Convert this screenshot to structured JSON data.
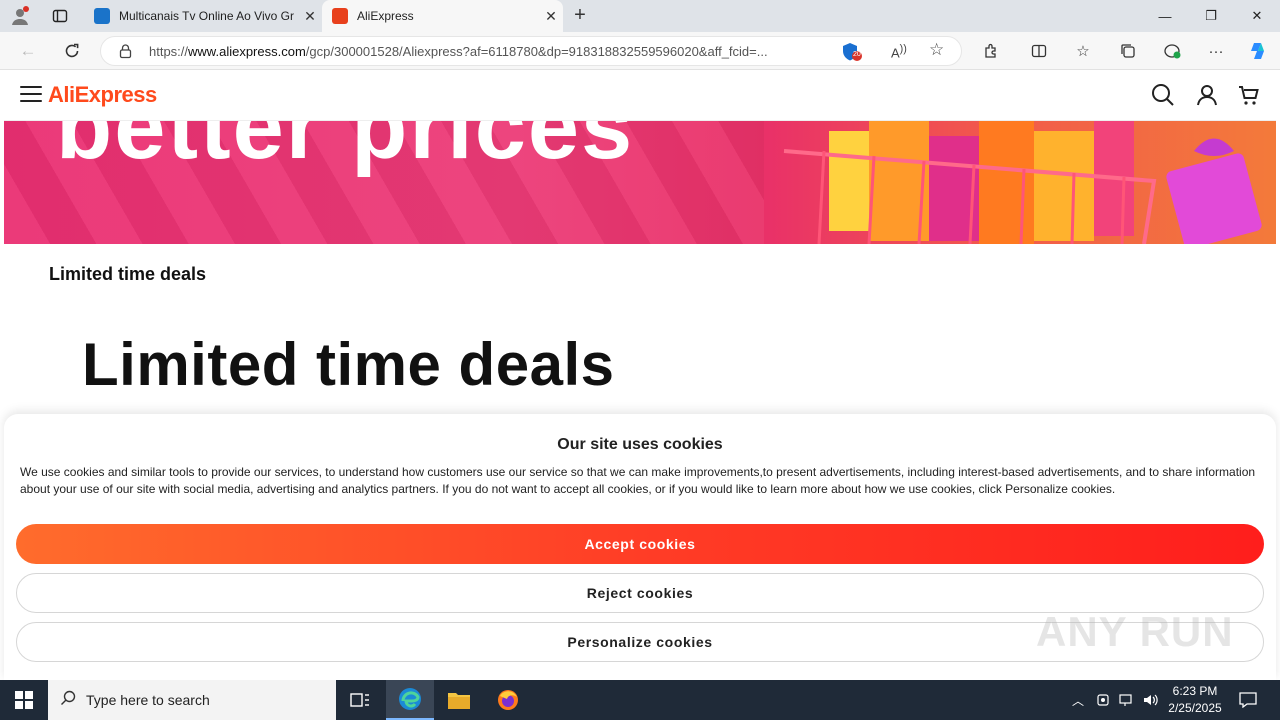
{
  "browser": {
    "tabs": [
      {
        "title": "Multicanais Tv Online Ao Vivo Gr",
        "favicon_color": "#1a73c9"
      },
      {
        "title": "AliExpress",
        "favicon_color": "#e8401c"
      }
    ],
    "url_prefix": "https://",
    "url_host": "www.aliexpress.com",
    "url_rest": "/gcp/300001528/Aliexpress?af=6118780&dp=918318832559596020&aff_fcid=...",
    "shield_badge_count": "20"
  },
  "site": {
    "logo": "AliExpress",
    "banner_text": "better prices",
    "section_label": "Limited time deals",
    "big_title": "Limited time deals"
  },
  "cookie": {
    "title": "Our site uses cookies",
    "text": "We use cookies and similar tools to provide our services, to understand how customers use our service so that we can make improvements,to present advertisements, including interest-based advertisements, and to share information about your use of our site with social media, advertising and analytics partners. If you do not want to accept all cookies, or if you would like to learn more about how we use cookies, click Personalize cookies.",
    "accept": "Accept cookies",
    "reject": "Reject cookies",
    "personalize": "Personalize cookies"
  },
  "watermark": "ANY RUN",
  "taskbar": {
    "search_placeholder": "Type here to search",
    "time": "6:23 PM",
    "date": "2/25/2025"
  },
  "colors": {
    "brand": "#ff4a1c",
    "accept_start": "#ff6c2c",
    "accept_end": "#ff1e1c",
    "banner_pink": "#ea2f72"
  }
}
